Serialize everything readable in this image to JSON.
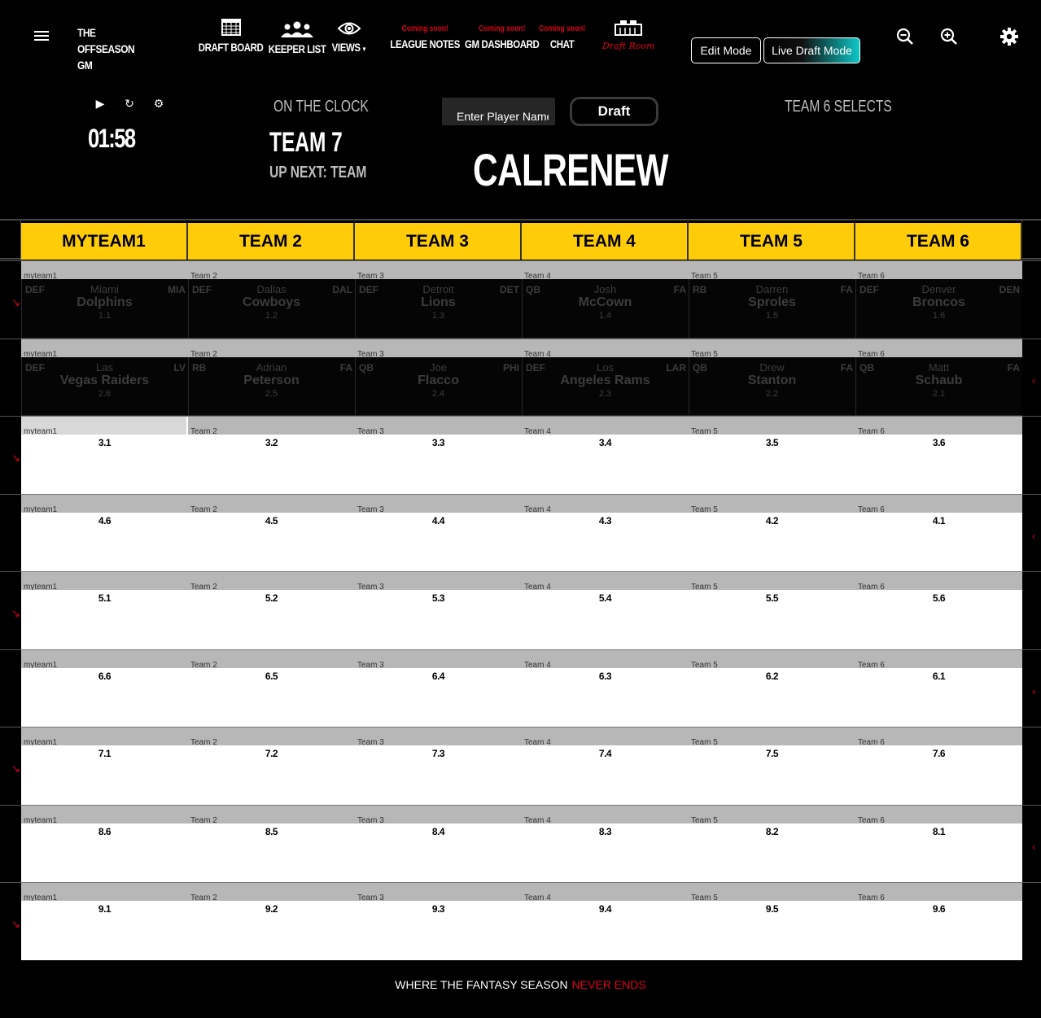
{
  "brand": {
    "line1": "THE",
    "line2": "OFFSEASON",
    "line3": "GM"
  },
  "nav": {
    "draft_board": "DRAFT BOARD",
    "keeper_list": "KEEPER LIST",
    "views": "VIEWS",
    "league_notes": "LEAGUE NOTES",
    "gm_dashboard": "GM DASHBOARD",
    "chat": "CHAT",
    "coming_soon": "Coming soon!",
    "draft_room": "Draft Room"
  },
  "modes": {
    "edit": "Edit Mode",
    "live": "Live Draft Mode"
  },
  "clock": {
    "timer": "01:58",
    "on_the_clock_label": "ON THE CLOCK",
    "on_the_clock_team": "TEAM 7",
    "up_next": "UP NEXT: TEAM",
    "player_placeholder": "Enter Player Name",
    "draft_button": "Draft",
    "selected_player": "CALRENEW",
    "selects_label": "TEAM 6 SELECTS"
  },
  "teams": [
    "MYTEAM1",
    "TEAM 2",
    "TEAM 3",
    "TEAM 4",
    "TEAM 5",
    "TEAM 6"
  ],
  "owners": [
    "myteam1",
    "Team 2",
    "Team 3",
    "Team 4",
    "Team 5",
    "Team 6"
  ],
  "rounds": [
    {
      "filled": true,
      "picks": [
        {
          "pos": "DEF",
          "first": "Miami",
          "last": "Dolphins",
          "nfl": "MIA",
          "num": "1.1"
        },
        {
          "pos": "DEF",
          "first": "Dallas",
          "last": "Cowboys",
          "nfl": "DAL",
          "num": "1.2"
        },
        {
          "pos": "DEF",
          "first": "Detroit",
          "last": "Lions",
          "nfl": "DET",
          "num": "1.3"
        },
        {
          "pos": "QB",
          "first": "Josh",
          "last": "McCown",
          "nfl": "FA",
          "num": "1.4"
        },
        {
          "pos": "RB",
          "first": "Darren",
          "last": "Sproles",
          "nfl": "FA",
          "num": "1.5"
        },
        {
          "pos": "DEF",
          "first": "Denver",
          "last": "Broncos",
          "nfl": "DEN",
          "num": "1.6"
        }
      ]
    },
    {
      "filled": true,
      "picks": [
        {
          "pos": "DEF",
          "first": "Las",
          "last": "Vegas Raiders",
          "nfl": "LV",
          "num": "2.6"
        },
        {
          "pos": "RB",
          "first": "Adrian",
          "last": "Peterson",
          "nfl": "FA",
          "num": "2.5"
        },
        {
          "pos": "QB",
          "first": "Joe",
          "last": "Flacco",
          "nfl": "PHI",
          "num": "2.4"
        },
        {
          "pos": "DEF",
          "first": "Los",
          "last": "Angeles Rams",
          "nfl": "LAR",
          "num": "2.3"
        },
        {
          "pos": "QB",
          "first": "Drew",
          "last": "Stanton",
          "nfl": "FA",
          "num": "2.2"
        },
        {
          "pos": "QB",
          "first": "Matt",
          "last": "Schaub",
          "nfl": "FA",
          "num": "2.1"
        }
      ]
    },
    {
      "filled": false,
      "picks": [
        "3.1",
        "3.2",
        "3.3",
        "3.4",
        "3.5",
        "3.6"
      ]
    },
    {
      "filled": false,
      "picks": [
        "4.6",
        "4.5",
        "4.4",
        "4.3",
        "4.2",
        "4.1"
      ]
    },
    {
      "filled": false,
      "picks": [
        "5.1",
        "5.2",
        "5.3",
        "5.4",
        "5.5",
        "5.6"
      ]
    },
    {
      "filled": false,
      "picks": [
        "6.6",
        "6.5",
        "6.4",
        "6.3",
        "6.2",
        "6.1"
      ]
    },
    {
      "filled": false,
      "picks": [
        "7.1",
        "7.2",
        "7.3",
        "7.4",
        "7.5",
        "7.6"
      ]
    },
    {
      "filled": false,
      "picks": [
        "8.6",
        "8.5",
        "8.4",
        "8.3",
        "8.2",
        "8.1"
      ]
    },
    {
      "filled": false,
      "picks": [
        "9.1",
        "9.2",
        "9.3",
        "9.4",
        "9.5",
        "9.6"
      ]
    }
  ],
  "footer": {
    "text": "WHERE THE FANTASY SEASON",
    "accent": "NEVER ENDS"
  },
  "colors": {
    "accent": "#e0001a",
    "header_yellow": "#ffcc0a",
    "live_mode": "#0fc7c7"
  }
}
